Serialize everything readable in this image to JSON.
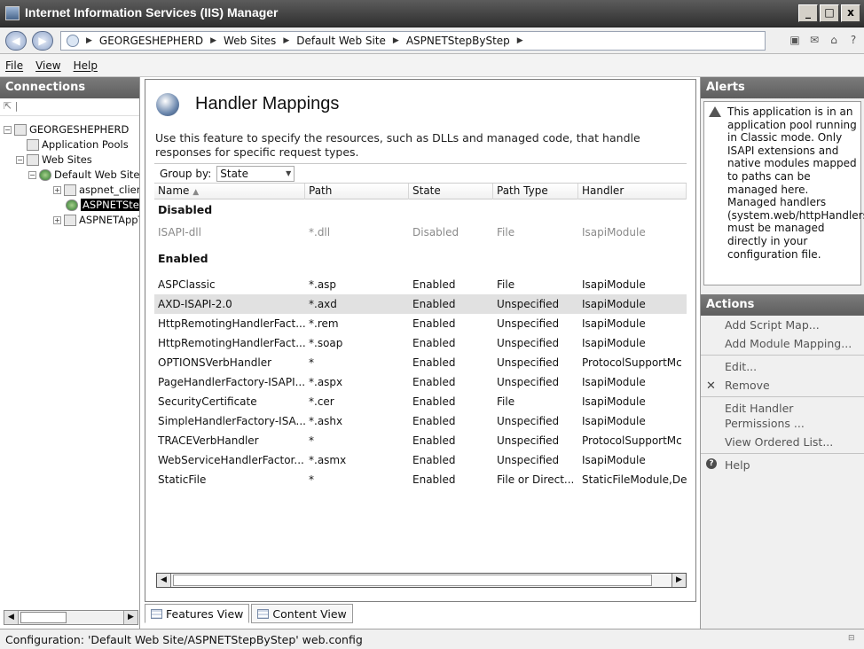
{
  "window": {
    "title": "Internet Information Services (IIS) Manager",
    "controls": [
      "_",
      "□",
      "x"
    ]
  },
  "address": {
    "crumbs": [
      "GEORGESHEPHERD",
      "Web Sites",
      "Default Web Site",
      "ASPNETStepByStep"
    ]
  },
  "menu": {
    "file": "File",
    "view": "View",
    "help": "Help"
  },
  "connections": {
    "header": "Connections",
    "tree": [
      {
        "label": "GEORGESHEPHERD",
        "level": 0
      },
      {
        "label": "Application Pools",
        "level": 1
      },
      {
        "label": "Web Sites",
        "level": 1
      },
      {
        "label": "Default Web Site",
        "level": 2
      },
      {
        "label": "aspnet_client",
        "level": 3
      },
      {
        "label": "ASPNETStepByStep",
        "level": 3
      },
      {
        "label": "ASPNETAppThree",
        "level": 3
      }
    ]
  },
  "feature": {
    "title": "Handler Mappings",
    "description": "Use this feature to specify the resources, such as DLLs and managed code, that handle responses for specific request types.",
    "group_by_label": "Group by:",
    "group_by_value": "State"
  },
  "grid": {
    "columns": {
      "name": "Name",
      "path": "Path",
      "state": "State",
      "type": "Path Type",
      "handler": "Handler"
    },
    "groups": {
      "disabled": "Disabled",
      "enabled": "Enabled"
    },
    "disabled_rows": [
      {
        "name": "ISAPI-dll",
        "path": "*.dll",
        "state": "Disabled",
        "type": "File",
        "handler": "IsapiModule"
      }
    ],
    "enabled_rows": [
      {
        "name": "ASPClassic",
        "path": "*.asp",
        "state": "Enabled",
        "type": "File",
        "handler": "IsapiModule"
      },
      {
        "name": "AXD-ISAPI-2.0",
        "path": "*.axd",
        "state": "Enabled",
        "type": "Unspecified",
        "handler": "IsapiModule"
      },
      {
        "name": "HttpRemotingHandlerFact...",
        "path": "*.rem",
        "state": "Enabled",
        "type": "Unspecified",
        "handler": "IsapiModule"
      },
      {
        "name": "HttpRemotingHandlerFact...",
        "path": "*.soap",
        "state": "Enabled",
        "type": "Unspecified",
        "handler": "IsapiModule"
      },
      {
        "name": "OPTIONSVerbHandler",
        "path": "*",
        "state": "Enabled",
        "type": "Unspecified",
        "handler": "ProtocolSupportMc"
      },
      {
        "name": "PageHandlerFactory-ISAPI...",
        "path": "*.aspx",
        "state": "Enabled",
        "type": "Unspecified",
        "handler": "IsapiModule"
      },
      {
        "name": "SecurityCertificate",
        "path": "*.cer",
        "state": "Enabled",
        "type": "File",
        "handler": "IsapiModule"
      },
      {
        "name": "SimpleHandlerFactory-ISA...",
        "path": "*.ashx",
        "state": "Enabled",
        "type": "Unspecified",
        "handler": "IsapiModule"
      },
      {
        "name": "TRACEVerbHandler",
        "path": "*",
        "state": "Enabled",
        "type": "Unspecified",
        "handler": "ProtocolSupportMc"
      },
      {
        "name": "WebServiceHandlerFactor...",
        "path": "*.asmx",
        "state": "Enabled",
        "type": "Unspecified",
        "handler": "IsapiModule"
      },
      {
        "name": "StaticFile",
        "path": "*",
        "state": "Enabled",
        "type": "File or Direct...",
        "handler": "StaticFileModule,De"
      }
    ]
  },
  "tabs": {
    "features": "Features View",
    "content": "Content View"
  },
  "alerts": {
    "header": "Alerts",
    "text": "This application is in an application pool running in Classic mode.  Only ISAPI extensions and native modules mapped to paths can be managed here. Managed handlers (system.web/httpHandlers) must be managed directly in your configuration file."
  },
  "actions": {
    "header": "Actions",
    "add_script_map": "Add Script Map...",
    "add_module_mapping": "Add Module Mapping...",
    "edit": "Edit...",
    "remove": "Remove",
    "edit_permissions": "Edit Handler Permissions ...",
    "view_ordered_list": "View Ordered List...",
    "help": "Help"
  },
  "status": {
    "text": "Configuration: 'Default Web Site/ASPNETStepByStep' web.config"
  }
}
